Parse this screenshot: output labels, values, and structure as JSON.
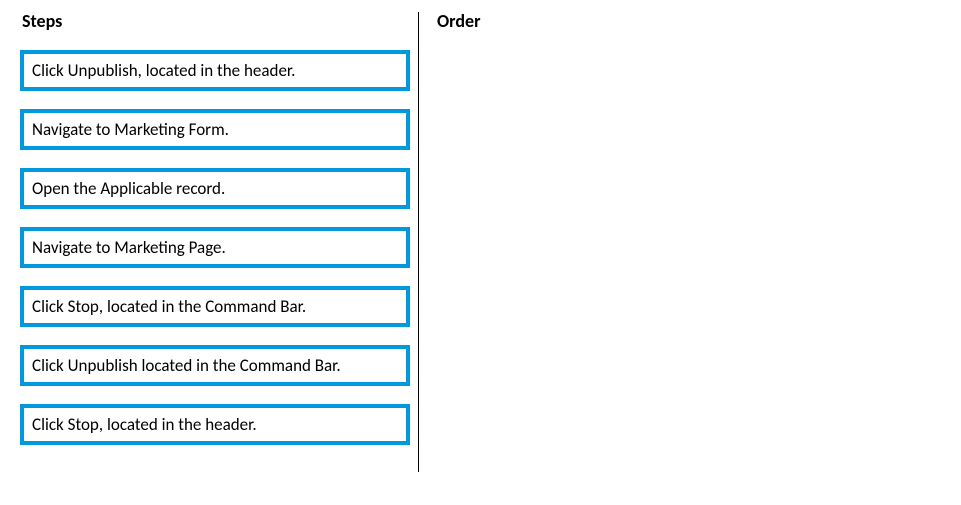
{
  "columns": {
    "steps": {
      "header": "Steps",
      "items": [
        "Click Unpublish, located in the header.",
        "Navigate to Marketing Form.",
        "Open the Applicable record.",
        "Navigate to Marketing Page.",
        "Click Stop, located in the Command Bar.",
        "Click Unpublish located in the Command Bar.",
        "Click Stop, located in the header."
      ]
    },
    "order": {
      "header": "Order",
      "items": []
    }
  },
  "colors": {
    "border": "#0099dd",
    "text": "#000000",
    "background": "#ffffff"
  }
}
